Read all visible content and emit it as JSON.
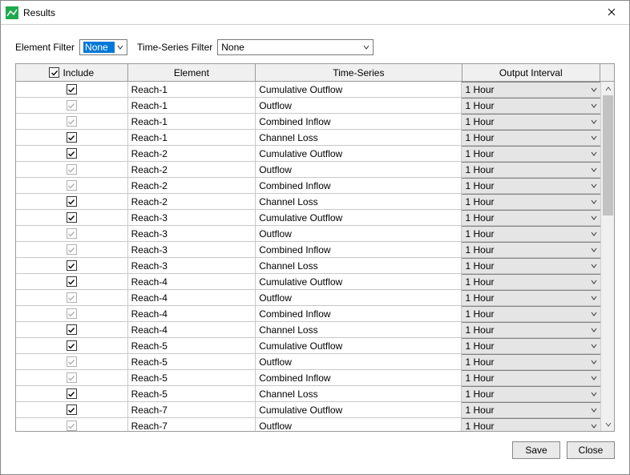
{
  "window": {
    "title": "Results"
  },
  "filters": {
    "element_label": "Element Filter",
    "element_value": "None",
    "timeseries_label": "Time-Series Filter",
    "timeseries_value": "None"
  },
  "table": {
    "headers": {
      "include": "Include",
      "element": "Element",
      "timeseries": "Time-Series",
      "interval": "Output Interval"
    },
    "rows": [
      {
        "checked": true,
        "enabled": true,
        "element": "Reach-1",
        "series": "Cumulative Outflow",
        "interval": "1 Hour"
      },
      {
        "checked": true,
        "enabled": false,
        "element": "Reach-1",
        "series": "Outflow",
        "interval": "1 Hour"
      },
      {
        "checked": true,
        "enabled": false,
        "element": "Reach-1",
        "series": "Combined Inflow",
        "interval": "1 Hour"
      },
      {
        "checked": true,
        "enabled": true,
        "element": "Reach-1",
        "series": "Channel Loss",
        "interval": "1 Hour"
      },
      {
        "checked": true,
        "enabled": true,
        "element": "Reach-2",
        "series": "Cumulative Outflow",
        "interval": "1 Hour"
      },
      {
        "checked": true,
        "enabled": false,
        "element": "Reach-2",
        "series": "Outflow",
        "interval": "1 Hour"
      },
      {
        "checked": true,
        "enabled": false,
        "element": "Reach-2",
        "series": "Combined Inflow",
        "interval": "1 Hour"
      },
      {
        "checked": true,
        "enabled": true,
        "element": "Reach-2",
        "series": "Channel Loss",
        "interval": "1 Hour"
      },
      {
        "checked": true,
        "enabled": true,
        "element": "Reach-3",
        "series": "Cumulative Outflow",
        "interval": "1 Hour"
      },
      {
        "checked": true,
        "enabled": false,
        "element": "Reach-3",
        "series": "Outflow",
        "interval": "1 Hour"
      },
      {
        "checked": true,
        "enabled": false,
        "element": "Reach-3",
        "series": "Combined Inflow",
        "interval": "1 Hour"
      },
      {
        "checked": true,
        "enabled": true,
        "element": "Reach-3",
        "series": "Channel Loss",
        "interval": "1 Hour"
      },
      {
        "checked": true,
        "enabled": true,
        "element": "Reach-4",
        "series": "Cumulative Outflow",
        "interval": "1 Hour"
      },
      {
        "checked": true,
        "enabled": false,
        "element": "Reach-4",
        "series": "Outflow",
        "interval": "1 Hour"
      },
      {
        "checked": true,
        "enabled": false,
        "element": "Reach-4",
        "series": "Combined Inflow",
        "interval": "1 Hour"
      },
      {
        "checked": true,
        "enabled": true,
        "element": "Reach-4",
        "series": "Channel Loss",
        "interval": "1 Hour"
      },
      {
        "checked": true,
        "enabled": true,
        "element": "Reach-5",
        "series": "Cumulative Outflow",
        "interval": "1 Hour"
      },
      {
        "checked": true,
        "enabled": false,
        "element": "Reach-5",
        "series": "Outflow",
        "interval": "1 Hour"
      },
      {
        "checked": true,
        "enabled": false,
        "element": "Reach-5",
        "series": "Combined Inflow",
        "interval": "1 Hour"
      },
      {
        "checked": true,
        "enabled": true,
        "element": "Reach-5",
        "series": "Channel Loss",
        "interval": "1 Hour"
      },
      {
        "checked": true,
        "enabled": true,
        "element": "Reach-7",
        "series": "Cumulative Outflow",
        "interval": "1 Hour"
      },
      {
        "checked": true,
        "enabled": false,
        "element": "Reach-7",
        "series": "Outflow",
        "interval": "1 Hour"
      }
    ]
  },
  "buttons": {
    "save": "Save",
    "close": "Close"
  }
}
